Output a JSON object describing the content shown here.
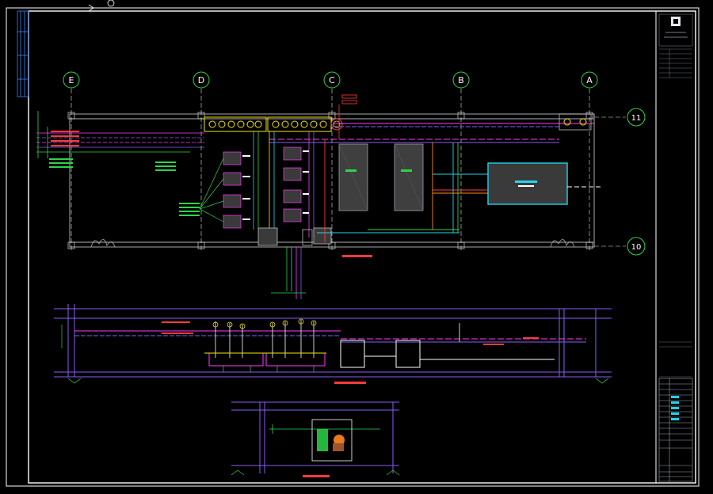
{
  "grid": {
    "columns": [
      "E",
      "D",
      "C",
      "B",
      "A"
    ],
    "rows": [
      "11",
      "10"
    ]
  },
  "colors": {
    "background": "#000000",
    "frame": "#ffffff",
    "wall": "#8c8c8c",
    "grid_axis": "#e0e0e0",
    "grid_bubble": "#2bd64a",
    "pipe_magenta": "#ff3cff",
    "pipe_violet": "#8b5cf6",
    "pipe_cyan": "#22d3ee",
    "pipe_green": "#2bd64a",
    "pipe_yellow": "#f5e60a",
    "pipe_red": "#ff3b3b",
    "pipe_orange": "#ff8a1f",
    "equipment_fill": "#3a3a3a"
  },
  "title_block": {
    "logo_icon": "company-logo-icon"
  }
}
